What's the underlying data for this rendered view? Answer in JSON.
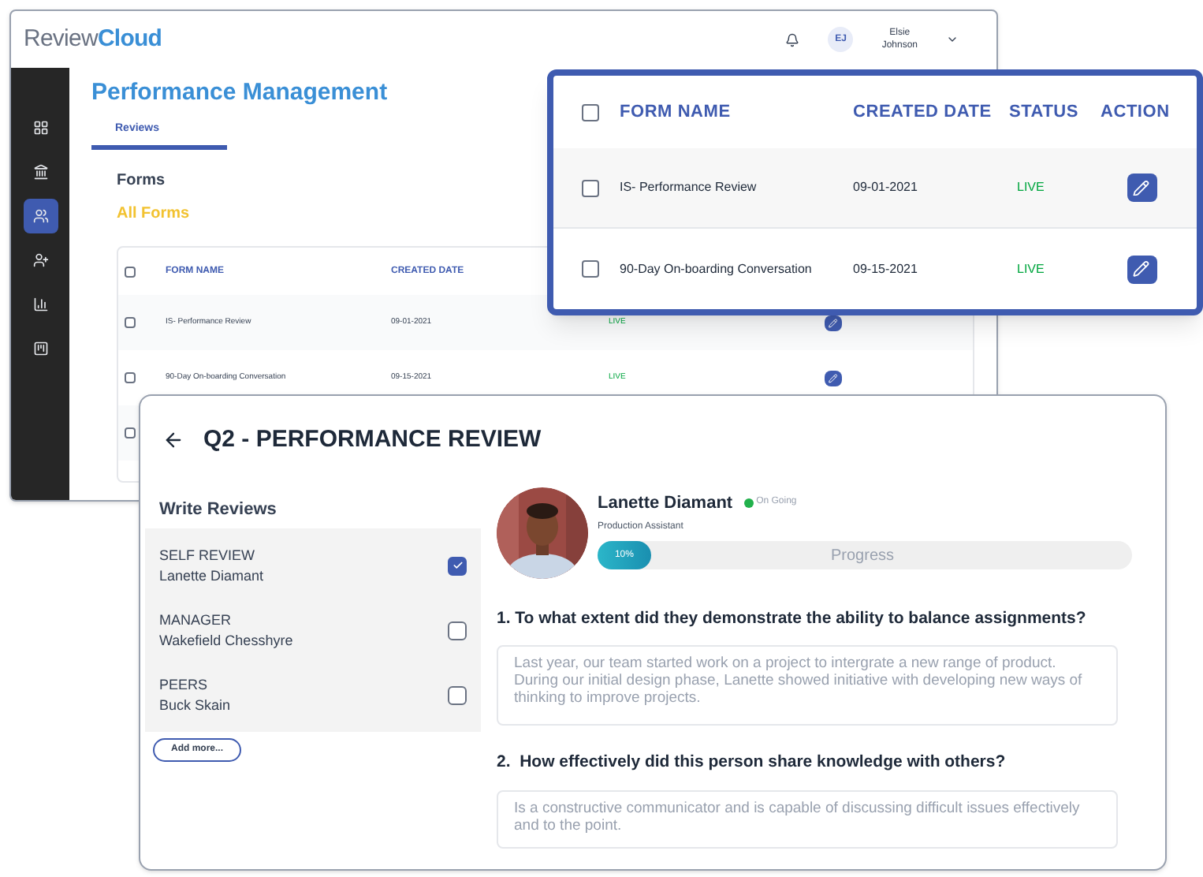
{
  "app": {
    "logo": {
      "prefix": "Review",
      "suffix": "Cloud"
    },
    "user": {
      "initials": "EJ",
      "first_name": "Elsie",
      "last_name": "Johnson"
    }
  },
  "sidebar": {
    "items": [
      {
        "kind": "grid",
        "selected": false
      },
      {
        "kind": "bank",
        "selected": false
      },
      {
        "kind": "people",
        "selected": true
      },
      {
        "kind": "person-add",
        "selected": false
      },
      {
        "kind": "chart",
        "selected": false
      },
      {
        "kind": "report",
        "selected": false
      }
    ]
  },
  "page": {
    "title": "Performance Management",
    "tabs": [
      {
        "label": "Reviews",
        "selected": true
      }
    ],
    "section": "Forms",
    "filter": "All Forms"
  },
  "forms_table": {
    "header_checked": false,
    "columns": [
      "FORM NAME",
      "CREATED DATE"
    ],
    "rows": [
      {
        "checked": false,
        "name": "IS- Performance Review",
        "date": "09-01-2021",
        "status": "LIVE"
      },
      {
        "checked": false,
        "name": "90-Day On-boarding Conversation",
        "date": "09-15-2021",
        "status": "LIVE"
      },
      {
        "checked": false
      }
    ]
  },
  "zoom_table": {
    "header_checked": false,
    "columns": [
      "FORM NAME",
      "CREATED DATE",
      "STATUS",
      "ACTION"
    ],
    "rows": [
      {
        "checked": false,
        "name": "IS- Performance Review",
        "date": "09-01-2021",
        "status": "LIVE"
      },
      {
        "checked": false,
        "name": "90-Day On-boarding Conversation",
        "date": "09-15-2021",
        "status": "LIVE"
      }
    ]
  },
  "review": {
    "title": "Q2 - PERFORMANCE REVIEW",
    "list_title": "Write Reviews",
    "reviewers": [
      {
        "role": "SELF REVIEW",
        "name": "Lanette Diamant",
        "checked": true
      },
      {
        "role": "MANAGER",
        "name": "Wakefield Chesshyre",
        "checked": false
      },
      {
        "role": "PEERS",
        "name": "Buck Skain",
        "checked": false
      }
    ],
    "add_button": "Add more...",
    "person": {
      "name": "Lanette Diamant",
      "status": "On Going",
      "role": "Production Assistant",
      "progress": {
        "level": 0.1,
        "label": "10%",
        "caption": "Progress"
      }
    },
    "questions": [
      {
        "text": "1. To what extent did they demonstrate the ability to balance assignments?",
        "placeholder": "Last year, our team started work on a project to intergrate a new range of product. During our initial design phase, Lanette showed initiative with developing new ways of thinking to improve projects."
      },
      {
        "text": "2.  How effectively did this person share knowledge with others?",
        "placeholder": "Is a constructive communicator and is capable of discussing difficult issues effectively and to the point."
      }
    ]
  }
}
